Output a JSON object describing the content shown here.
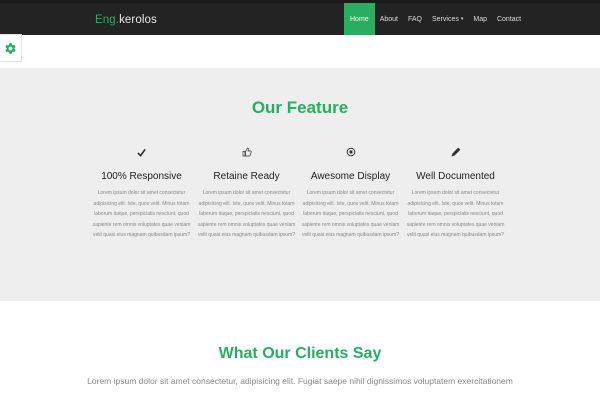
{
  "navbar": {
    "brand_accent": "Eng.",
    "brand_rest": "kerolos",
    "items": [
      {
        "label": "Home"
      },
      {
        "label": "About"
      },
      {
        "label": "FAQ"
      },
      {
        "label": "Services",
        "caret": "▾"
      },
      {
        "label": "Map"
      },
      {
        "label": "Contact"
      }
    ],
    "active_item": "Home"
  },
  "settings_tab": {
    "icon": "gear-icon"
  },
  "features": {
    "title": "Our Feature",
    "items": [
      {
        "icon": "check-icon",
        "name": "100% Responsive",
        "description": "Lorem ipsum dolor sit amet consectetur adipisicing elit. Iste, quos velit. Minus totam laborum itaque, perspiciatis nesciunt, quod sapiente rem omnis voluptates quae veniam velit quasi eius magnam quibusdam ipsum?"
      },
      {
        "icon": "thumbs-up-icon",
        "name": "Retaine Ready",
        "description": "Lorem ipsum dolor sit amet consectetur adipisicing elit. Iste, quos velit. Minus totam laborum itaque, perspiciatis nesciunt, quod sapiente rem omnis voluptates quae veniam velit quasi eius magnam quibusdam ipsum?"
      },
      {
        "icon": "eye-icon",
        "name": "Awesome Display",
        "description": "Lorem ipsum dolor sit amet consectetur adipisicing elit. Iste, quos velit. Minus totam laborum itaque, perspiciatis nesciunt, quod sapiente rem omnis voluptates quae veniam velit quasi eius magnam quibusdam ipsum?"
      },
      {
        "icon": "pencil-icon",
        "name": "Well Documented",
        "description": "Lorem ipsum dolor sit amet consectetur adipisicing elit. Iste, quos velit. Minus totam laborum itaque, perspiciatis nesciunt, quod sapiente rem omnis voluptates quae veniam velit quasi eius magnam quibusdam ipsum?"
      }
    ]
  },
  "clients": {
    "title": "What Our Clients Say",
    "subtitle": "Lorem ipsum dolor sit amet consectetur, adipisicing elit. Fugiat saepe nihil dignissimos voluptatem exercitationem"
  },
  "colors": {
    "accent": "#27ae60",
    "navbar_bg": "#232323",
    "section_bg": "#eeeeee"
  }
}
